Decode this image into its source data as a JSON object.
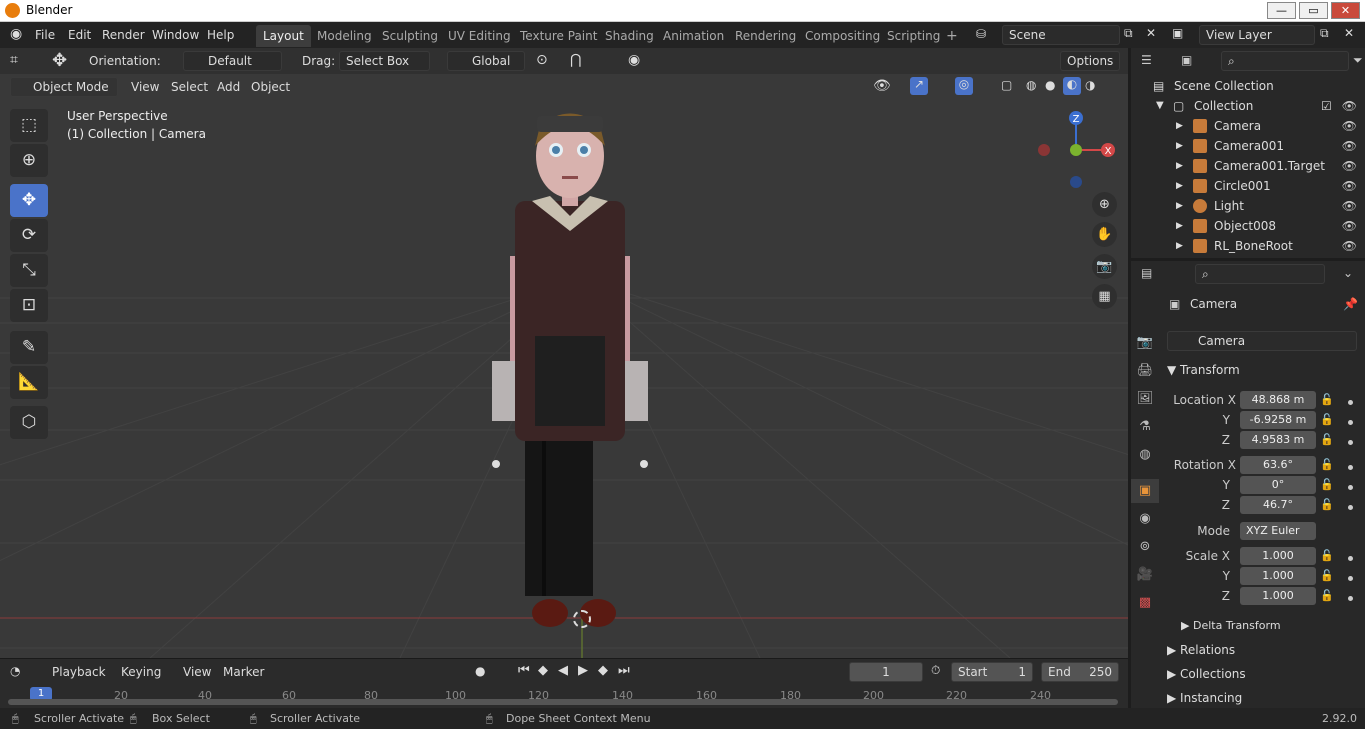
{
  "app": {
    "title": "Blender",
    "version": "2.92.0"
  },
  "window_controls": {
    "minimize": "—",
    "restore": "▭",
    "close": "✕"
  },
  "menubar": {
    "items": [
      "File",
      "Edit",
      "Render",
      "Window",
      "Help"
    ]
  },
  "workspaces": {
    "active": "Layout",
    "items": [
      "Layout",
      "Modeling",
      "Sculpting",
      "UV Editing",
      "Texture Paint",
      "Shading",
      "Animation",
      "Rendering",
      "Compositing",
      "Scripting"
    ],
    "add": "+"
  },
  "scene": {
    "name": "Scene"
  },
  "view_layer": {
    "name": "View Layer"
  },
  "tool_header": {
    "orientation_label": "Orientation:",
    "orientation_value": "Default",
    "drag_label": "Drag:",
    "drag_value": "Select Box",
    "transform_orientation": "Global",
    "options": "Options"
  },
  "viewport_header": {
    "mode": "Object Mode",
    "menus": [
      "View",
      "Select",
      "Add",
      "Object"
    ]
  },
  "viewport": {
    "perspective": "User Perspective",
    "context": "(1) Collection | Camera"
  },
  "gizmo": {
    "z": "Z",
    "x": "X"
  },
  "timeline": {
    "menus": [
      "Playback",
      "Keying",
      "View",
      "Marker"
    ],
    "current_frame": "1",
    "start_label": "Start",
    "start": "1",
    "end_label": "End",
    "end": "250",
    "ticks": [
      "20",
      "40",
      "60",
      "80",
      "100",
      "120",
      "140",
      "160",
      "180",
      "200",
      "220",
      "240"
    ],
    "marker": "1"
  },
  "status_bar": {
    "items": [
      "Scroller Activate",
      "Box Select",
      "Scroller Activate",
      "Dope Sheet Context Menu"
    ]
  },
  "outliner": {
    "root": "Scene Collection",
    "collection": "Collection",
    "items": [
      {
        "name": "Camera",
        "color": "#c77b3a"
      },
      {
        "name": "Camera001",
        "color": "#c77b3a"
      },
      {
        "name": "Camera001.Target",
        "color": "#c77b3a"
      },
      {
        "name": "Circle001",
        "color": "#c77b3a"
      },
      {
        "name": "Light",
        "color": "#c77b3a"
      },
      {
        "name": "Object008",
        "color": "#c77b3a"
      },
      {
        "name": "RL_BoneRoot",
        "color": "#c77b3a"
      }
    ]
  },
  "properties": {
    "object_name": "Camera",
    "datablock": "Camera",
    "transform_title": "Transform",
    "location": {
      "label": "Location X",
      "x": "48.868 m",
      "y": "-6.9258 m",
      "z": "4.9583 m"
    },
    "rotation": {
      "label": "Rotation X",
      "x": "63.6°",
      "y": "0°",
      "z": "46.7°"
    },
    "mode_label": "Mode",
    "mode": "XYZ Euler",
    "scale": {
      "label": "Scale X",
      "x": "1.000",
      "y": "1.000",
      "z": "1.000"
    },
    "axis_y": "Y",
    "axis_z": "Z",
    "sections": [
      "Delta Transform",
      "Relations",
      "Collections",
      "Instancing"
    ]
  }
}
